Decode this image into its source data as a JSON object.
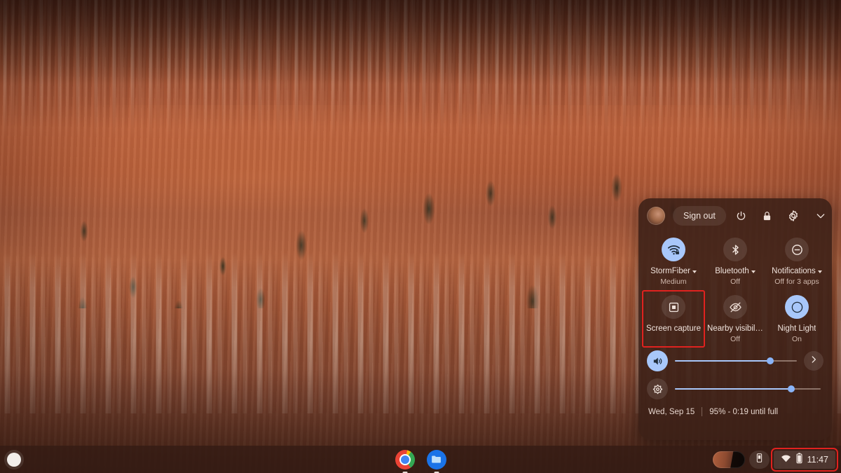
{
  "wallpaper": {
    "description": "Bryce Canyon hoodoos at sunrise",
    "base_color": "#8a4328"
  },
  "quick_settings": {
    "header": {
      "avatar_name": "user-avatar",
      "sign_out_label": "Sign out",
      "power_icon": "power-icon",
      "lock_icon": "lock-icon",
      "settings_icon": "gear-icon",
      "collapse_icon": "chevron-down-icon"
    },
    "tiles": [
      {
        "id": "network",
        "icon": "wifi-locked-icon",
        "label": "StormFiber",
        "sublabel": "Medium",
        "has_caret": true,
        "state": "on"
      },
      {
        "id": "bluetooth",
        "icon": "bluetooth-icon",
        "label": "Bluetooth",
        "sublabel": "Off",
        "has_caret": true,
        "state": "off"
      },
      {
        "id": "notifications",
        "icon": "do-not-disturb-icon",
        "label": "Notifications",
        "sublabel": "Off for 3 apps",
        "has_caret": true,
        "state": "off"
      },
      {
        "id": "screen-capture",
        "icon": "screen-capture-icon",
        "label": "Screen capture",
        "sublabel": "",
        "has_caret": false,
        "state": "off",
        "highlighted": true
      },
      {
        "id": "nearby-visibility",
        "icon": "eye-slash-icon",
        "label": "Nearby visibil…",
        "sublabel": "Off",
        "has_caret": false,
        "state": "off"
      },
      {
        "id": "night-light",
        "icon": "moon-icon",
        "label": "Night Light",
        "sublabel": "On",
        "has_caret": false,
        "state": "on"
      }
    ],
    "sliders": [
      {
        "id": "volume",
        "icon": "volume-icon",
        "value": 78,
        "state": "on",
        "more_icon": "chevron-right-icon"
      },
      {
        "id": "brightness",
        "icon": "brightness-icon",
        "value": 80,
        "state": "off",
        "more_icon": ""
      }
    ],
    "footer": {
      "date": "Wed, Sep 15",
      "battery": "95% - 0:19 until full"
    }
  },
  "shelf": {
    "launcher_icon": "launcher-icon",
    "apps": [
      {
        "id": "chrome",
        "name": "Google Chrome",
        "icon": "chrome-icon",
        "running": true
      },
      {
        "id": "files",
        "name": "Files",
        "icon": "files-folder-icon",
        "running": true
      }
    ],
    "status_area": {
      "capture_thumbnail": "screenshot-thumbnail",
      "phone_hub_icon": "phone-icon",
      "tray": {
        "wifi_icon": "wifi-icon",
        "battery_icon": "battery-charging-icon",
        "time": "11:47",
        "highlighted": true
      }
    }
  },
  "annotations": {
    "highlight_color": "#e0221f",
    "boxes": [
      "screen-capture-tile",
      "system-tray-time"
    ]
  }
}
